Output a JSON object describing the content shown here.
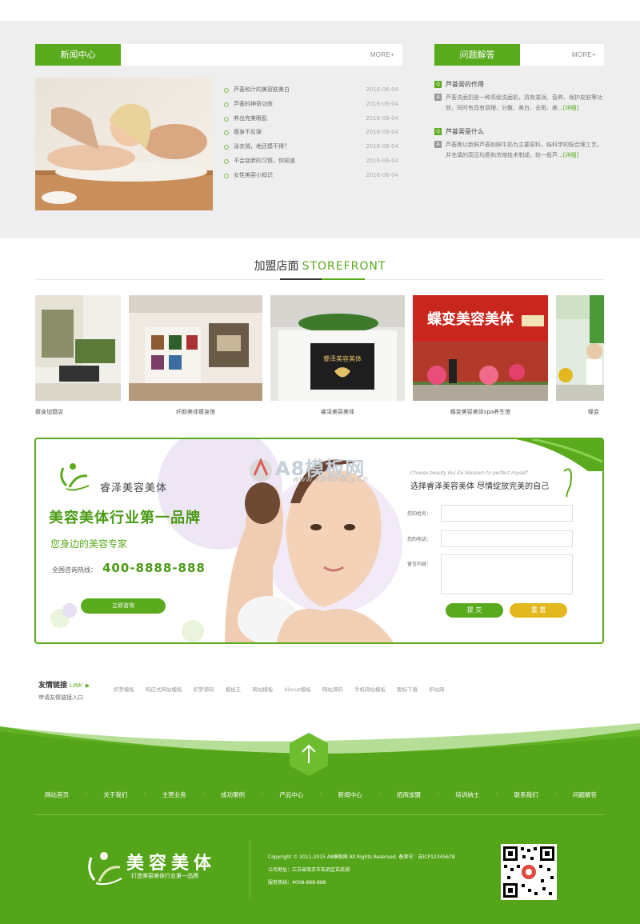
{
  "news": {
    "title": "新闻中心",
    "more": "MORE+",
    "items": [
      {
        "title": "芦荟和汁的美容肤美白",
        "date": "2016-06-04"
      },
      {
        "title": "芦荟的神奇功效",
        "date": "2016-06-04"
      },
      {
        "title": "养出完美眼肌",
        "date": "2016-06-04"
      },
      {
        "title": "瘦身不反弹",
        "date": "2016-06-04"
      },
      {
        "title": "泳衣俏，地还摸不得？",
        "date": "2016-06-04"
      },
      {
        "title": "不会变胖的习惯，你知道",
        "date": "2016-06-04"
      },
      {
        "title": "女性美容小知识",
        "date": "2016-06-04"
      }
    ]
  },
  "faq": {
    "title": "问题解答",
    "more": "MORE+",
    "items": [
      {
        "q": "芦荟膏的作用",
        "a": "芦荟洗面奶是一种高级洗面奶，具有滋润、营养、保护皮肤等功效，同时有具有调理、分散、美白、去斑、美...",
        "detail": "[详细]"
      },
      {
        "q": "芦荟膏是什么",
        "a": "芦荟膏以新鲜芦荟和鲜牛奶为主要原料，结科学的配合理工艺，并充填的高压均质和浓缩技术制成，较一般芦...",
        "detail": "[详细]"
      }
    ]
  },
  "storefront": {
    "title_cn": "加盟店面",
    "title_en": "STOREFRONT",
    "stores": [
      {
        "caption": "瘦身加盟店"
      },
      {
        "caption": "纤颜美体瘦身馆"
      },
      {
        "caption": "睿泽美容美体"
      },
      {
        "caption": "蝶变美容美体spa养生馆"
      },
      {
        "caption": "蝶变"
      }
    ],
    "sign4": "蝶变美容美体"
  },
  "watermark": {
    "text": "A8模板网",
    "url": "www.AdminBuy.Cn"
  },
  "banner": {
    "brand": "睿泽美容美体",
    "slogan": "美容美体行业第一品牌",
    "sub": "您身边的美容专家",
    "hotline_label": "全国咨询热线：",
    "hotline": "400-8888-888",
    "consult_btn": "立即咨询",
    "en_tagline": "Choose beauty Rui Ze blossom to perfect myself",
    "choose": "选择睿泽美容美体  尽情绽放完美的自己",
    "form": {
      "name_label": "您的姓名：",
      "phone_label": "您的电话：",
      "msg_label": "留言内容：",
      "submit": "提 交",
      "reset": "重 置"
    }
  },
  "links": {
    "title": "友情链接",
    "title_en": "LINK",
    "apply": "申请友情链接入口",
    "items": [
      "织梦模板",
      "响应式网站模板",
      "织梦源码",
      "模板王",
      "网站模板",
      "discuz模板",
      "网站源码",
      "手机网站模板",
      "图标下载",
      "织站网"
    ]
  },
  "footer": {
    "nav": [
      "网站首页",
      "关于我们",
      "主营业务",
      "成功案例",
      "产品中心",
      "新闻中心",
      "招商加盟",
      "培训纳士",
      "联系我们",
      "问题解答"
    ],
    "logo": "美容美体",
    "logo_sub": "打造美容美体行业第一品牌",
    "copyright": "Copyright © 2011-2015 A8模板网 All Rights Reserved.  备案号：苏ICP12345678",
    "address": "公司地址：江苏省南京市玄武区玄武湖",
    "service": "服务热线：4008-888-888"
  },
  "colors": {
    "accent": "#5aaa1e",
    "gold": "#e3b71e",
    "band": "#eeeeee"
  }
}
